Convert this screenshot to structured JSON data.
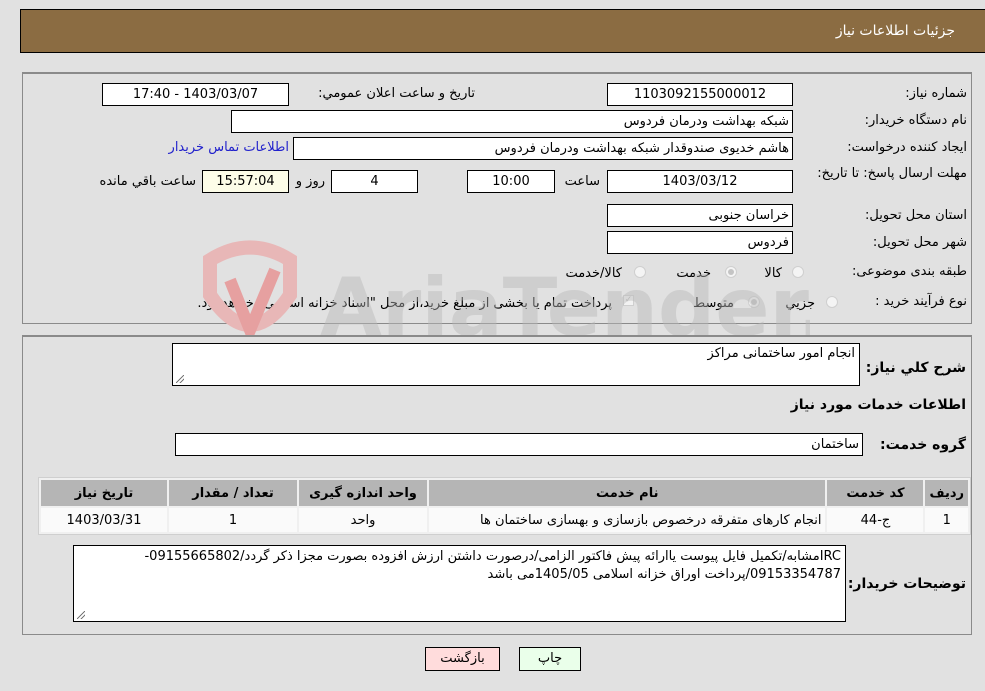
{
  "header": {
    "title": "جزئیات اطلاعات نیاز"
  },
  "details": {
    "need_number_label": "شماره نیاز:",
    "need_number": "1103092155000012",
    "announce_label": "تاریخ و ساعت اعلان عمومي:",
    "announce_value": "1403/03/07 - 17:40",
    "buyer_org_label": "نام دستگاه خريدار:",
    "buyer_org": "شبکه بهداشت ودرمان فردوس",
    "creator_label": "ایجاد کننده درخواست:",
    "creator": "هاشم خدیوی صندوقدار شبکه بهداشت ودرمان فردوس",
    "contact_link": "اطلاعات تماس خریدار",
    "deadline_label": "مهلت ارسال پاسخ: تا تاریخ:",
    "deadline_date": "1403/03/12",
    "time_label": "ساعت",
    "deadline_time": "10:00",
    "days_value": "4",
    "days_label": "روز و",
    "remaining_time": "15:57:04",
    "remaining_label": "ساعت باقي مانده",
    "province_label": "استان محل تحویل:",
    "province": "خراسان جنوبی",
    "city_label": "شهر محل تحویل:",
    "city": "فردوس",
    "category_label": "طبقه بندی موضوعی:",
    "category_options": [
      "کالا",
      "خدمت",
      "کالا/خدمت"
    ],
    "category_selected": "خدمت",
    "process_label": "نوع فرآیند خرید :",
    "process_options": [
      "جزيي",
      "متوسط"
    ],
    "process_selected": "متوسط",
    "treasury_note": "پرداخت تمام یا بخشی از مبلغ خرید،از محل \"اسناد خزانه اسلامی\" خواهد بود."
  },
  "services": {
    "summary_label": "شرح کلي نياز:",
    "summary": "انجام امور ساختمانی مراکز",
    "section_title": "اطلاعات خدمات مورد نیاز",
    "group_label": "گروه خدمت:",
    "group": "ساختمان",
    "table": {
      "headers": [
        "ردیف",
        "کد خدمت",
        "نام خدمت",
        "واحد اندازه گیری",
        "تعداد / مقدار",
        "تاریخ نیاز"
      ],
      "rows": [
        [
          "1",
          "ج-44",
          "انجام کارهای متفرقه درخصوص بازسازی و بهسازی ساختمان ها",
          "واحد",
          "1",
          "1403/03/31"
        ]
      ]
    },
    "buyer_notes_label": "توضیحات خریدار:",
    "buyer_notes": "IRCمشابه/تکمیل فایل پیوست یاارائه پیش فاکتور الزامی/درصورت داشتن ارزش افزوده بصورت مجزا ذکر گردد/09155665802-09153354787/پرداخت اوراق خزانه اسلامی 1405/05می باشد"
  },
  "buttons": {
    "print": "چاپ",
    "back": "بازگشت"
  },
  "watermark": {
    "text": "AriaTender.neT"
  }
}
